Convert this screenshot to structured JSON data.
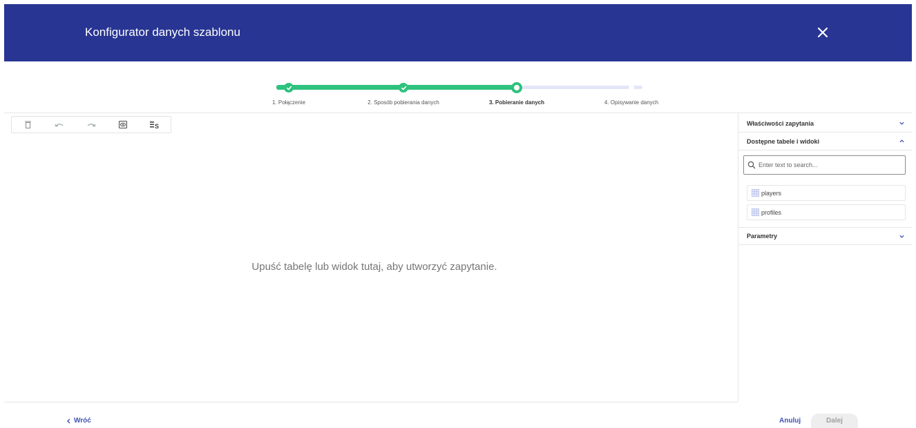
{
  "header": {
    "title": "Konfigurator danych szablonu",
    "bg_color": "#283593"
  },
  "stepper": {
    "accent_color": "#2ec27e",
    "current_step": 3,
    "steps": [
      {
        "label": "1. Połączenie",
        "state": "done"
      },
      {
        "label": "2. Sposób pobierania danych",
        "state": "done"
      },
      {
        "label": "3. Pobieranie danych",
        "state": "current"
      },
      {
        "label": "4. Opisywanie danych",
        "state": "future"
      }
    ]
  },
  "toolbar": {
    "icons": [
      "trash-icon",
      "undo-icon",
      "redo-icon",
      "preview-icon",
      "sql-icon"
    ]
  },
  "canvas": {
    "message": "Upuść tabelę lub widok tutaj, aby utworzyć zapytanie."
  },
  "side_panel": {
    "sections": [
      {
        "title": "Właściwości zapytania",
        "expanded": false
      },
      {
        "title": "Dostępne tabele i widoki",
        "expanded": true
      },
      {
        "title": "Parametry",
        "expanded": false
      }
    ],
    "search": {
      "placeholder": "Enter text to search...",
      "value": ""
    },
    "tables": [
      {
        "name": "players",
        "icon": "table-icon"
      },
      {
        "name": "profiles",
        "icon": "table-icon"
      }
    ]
  },
  "footer": {
    "back_label": "Wróć",
    "cancel_label": "Anuluj",
    "next_label": "Dalej",
    "link_color": "#3f51b5"
  }
}
